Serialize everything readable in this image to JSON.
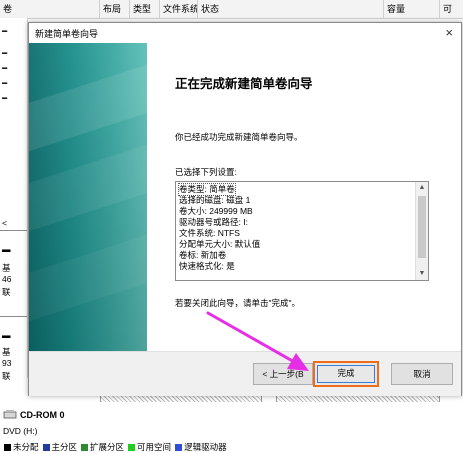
{
  "background": {
    "columns": [
      "卷",
      "布局",
      "类型",
      "文件系统",
      "状态",
      "容量",
      "可"
    ],
    "disk_rows": [
      {
        "l1": "基",
        "l2": "46",
        "l3": "联"
      },
      {
        "l1": "基",
        "l2": "93",
        "l3": "联"
      }
    ],
    "cdrom": {
      "name": "CD-ROM 0",
      "drive": "DVD (H:)"
    },
    "legend": [
      {
        "label": "未分配",
        "color": "#000000"
      },
      {
        "label": "主分区",
        "color": "#1f3d9b"
      },
      {
        "label": "扩展分区",
        "color": "#2e8b2e"
      },
      {
        "label": "可用空间",
        "color": "#22cc22"
      },
      {
        "label": "逻辑驱动器",
        "color": "#2e4fd6"
      }
    ]
  },
  "dialog": {
    "title": "新建简单卷向导",
    "heading": "正在完成新建简单卷向导",
    "completed_text": "你已经成功完成新建简单卷向导。",
    "selected_label": "已选择下列设置:",
    "settings": [
      "卷类型: 简单卷",
      "选择的磁盘: 磁盘 1",
      "卷大小: 249999 MB",
      "驱动器号或路径: I:",
      "文件系统: NTFS",
      "分配单元大小: 默认值",
      "卷标: 新加卷",
      "快速格式化: 是"
    ],
    "close_hint": "若要关闭此向导，请单击\"完成\"。",
    "buttons": {
      "back": "< 上一步(B",
      "finish": "完成",
      "cancel": "取消"
    }
  },
  "colors": {
    "accent_orange": "#ef6c1b",
    "arrow_magenta": "#e62ee6",
    "sidebar_teal": "#1a8d8a"
  }
}
